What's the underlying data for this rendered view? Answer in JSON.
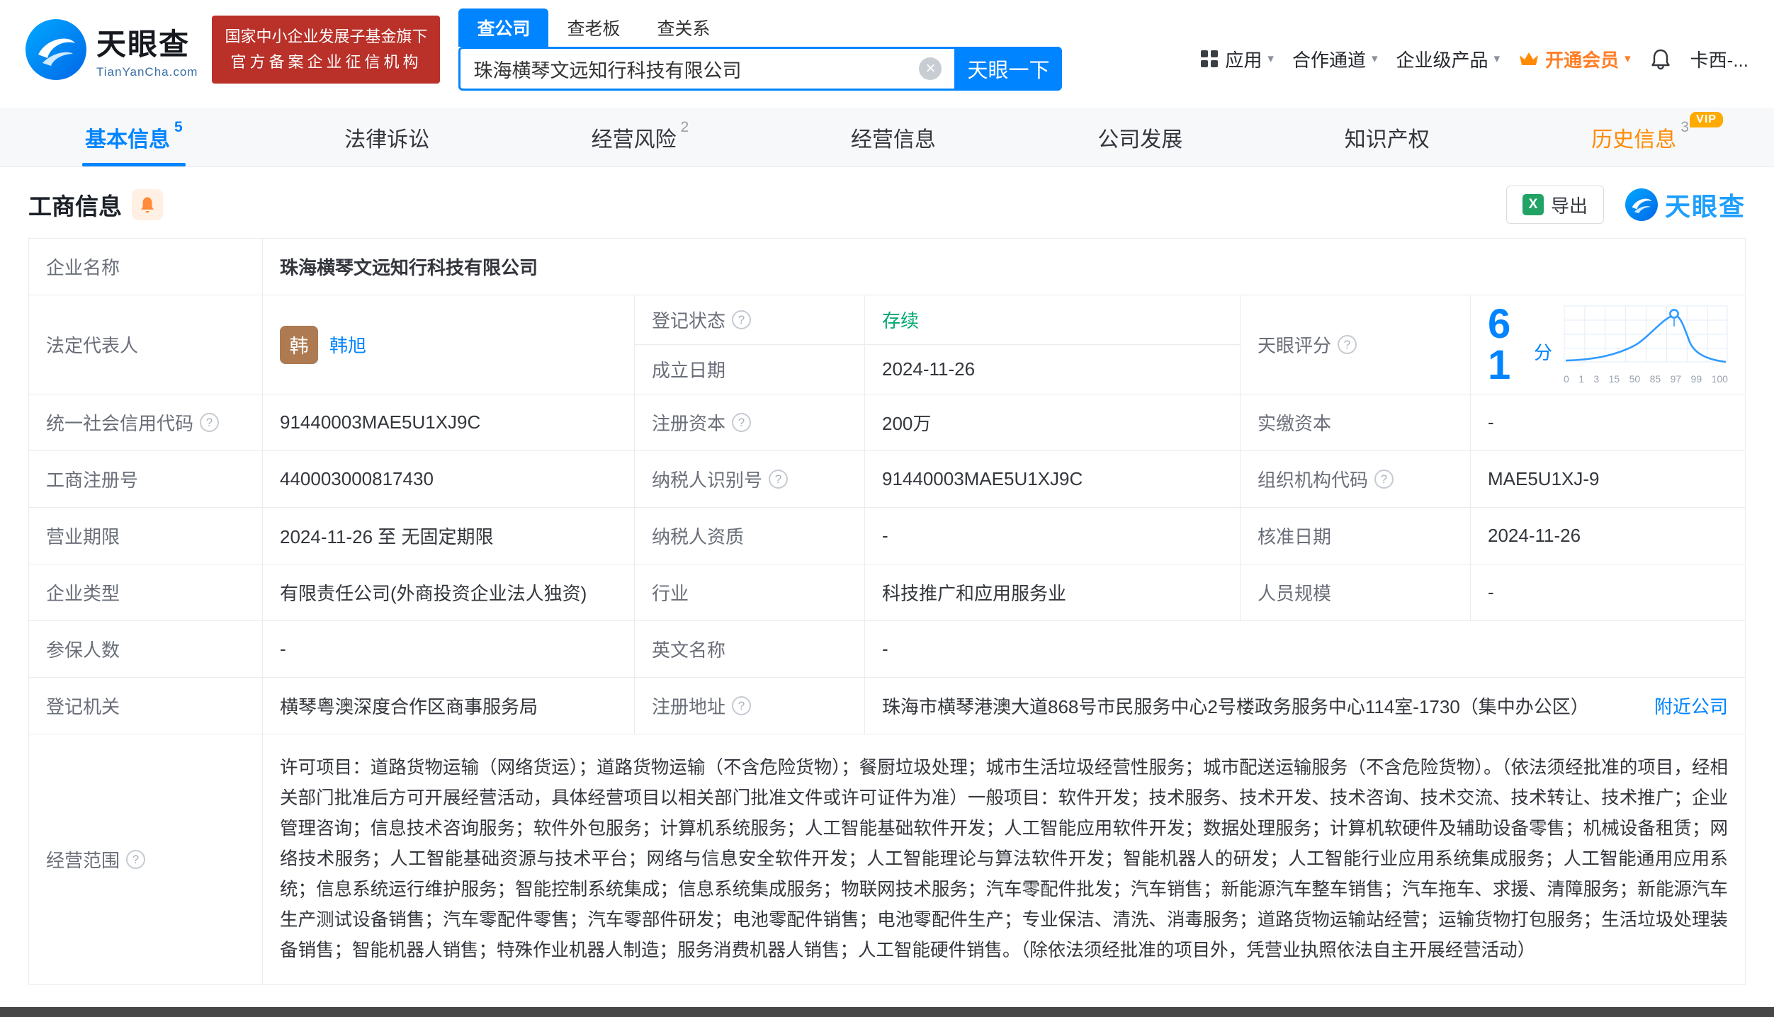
{
  "header": {
    "logo": {
      "cn": "天眼查",
      "en": "TianYanCha.com"
    },
    "badge": {
      "line1": "国家中小企业发展子基金旗下",
      "line2": "官方备案企业征信机构"
    },
    "search_tabs": [
      {
        "label": "查公司",
        "active": true
      },
      {
        "label": "查老板",
        "active": false
      },
      {
        "label": "查关系",
        "active": false
      }
    ],
    "search": {
      "value": "珠海横琴文远知行科技有限公司",
      "button": "天眼一下"
    },
    "nav": [
      {
        "label": "应用"
      },
      {
        "label": "合作通道"
      },
      {
        "label": "企业级产品"
      },
      {
        "label": "开通会员"
      }
    ],
    "user": "卡西-..."
  },
  "tabs": [
    {
      "label": "基本信息",
      "count": "5",
      "active": true
    },
    {
      "label": "法律诉讼",
      "count": ""
    },
    {
      "label": "经营风险",
      "count": "2"
    },
    {
      "label": "经营信息",
      "count": ""
    },
    {
      "label": "公司发展",
      "count": ""
    },
    {
      "label": "知识产权",
      "count": ""
    },
    {
      "label": "历史信息",
      "count": "3",
      "vip": "VIP"
    }
  ],
  "section": {
    "title": "工商信息",
    "export": "导出",
    "watermark": "天眼查"
  },
  "info": {
    "company_name": {
      "label": "企业名称",
      "value": "珠海横琴文远知行科技有限公司"
    },
    "legal_rep": {
      "label": "法定代表人",
      "avatar": "韩",
      "value": "韩旭"
    },
    "reg_status": {
      "label": "登记状态",
      "value": "存续"
    },
    "establish_date": {
      "label": "成立日期",
      "value": "2024-11-26"
    },
    "score": {
      "label": "天眼评分",
      "value": "61",
      "unit": "分"
    },
    "credit_code": {
      "label": "统一社会信用代码",
      "value": "91440003MAE5U1XJ9C"
    },
    "reg_capital": {
      "label": "注册资本",
      "value": "200万"
    },
    "paid_capital": {
      "label": "实缴资本",
      "value": "-"
    },
    "reg_number": {
      "label": "工商注册号",
      "value": "440003000817430"
    },
    "taxpayer_id": {
      "label": "纳税人识别号",
      "value": "91440003MAE5U1XJ9C"
    },
    "org_code": {
      "label": "组织机构代码",
      "value": "MAE5U1XJ-9"
    },
    "business_term": {
      "label": "营业期限",
      "value": "2024-11-26 至 无固定期限"
    },
    "taxpayer_quality": {
      "label": "纳税人资质",
      "value": "-"
    },
    "approval_date": {
      "label": "核准日期",
      "value": "2024-11-26"
    },
    "company_type": {
      "label": "企业类型",
      "value": "有限责任公司(外商投资企业法人独资)"
    },
    "industry": {
      "label": "行业",
      "value": "科技推广和应用服务业"
    },
    "staff_size": {
      "label": "人员规模",
      "value": "-"
    },
    "insured_count": {
      "label": "参保人数",
      "value": "-"
    },
    "english_name": {
      "label": "英文名称",
      "value": "-"
    },
    "reg_authority": {
      "label": "登记机关",
      "value": "横琴粤澳深度合作区商事服务局"
    },
    "reg_address": {
      "label": "注册地址",
      "value": "珠海市横琴港澳大道868号市民服务中心2号楼政务服务中心114室-1730（集中办公区）",
      "link": "附近公司"
    },
    "business_scope": {
      "label": "经营范围",
      "value": "许可项目：道路货物运输（网络货运）；道路货物运输（不含危险货物）；餐厨垃圾处理；城市生活垃圾经营性服务；城市配送运输服务（不含危险货物）。（依法须经批准的项目，经相关部门批准后方可开展经营活动，具体经营项目以相关部门批准文件或许可证件为准）一般项目：软件开发；技术服务、技术开发、技术咨询、技术交流、技术转让、技术推广；企业管理咨询；信息技术咨询服务；软件外包服务；计算机系统服务；人工智能基础软件开发；人工智能应用软件开发；数据处理服务；计算机软硬件及辅助设备零售；机械设备租赁；网络技术服务；人工智能基础资源与技术平台；网络与信息安全软件开发；人工智能理论与算法软件开发；智能机器人的研发；人工智能行业应用系统集成服务；人工智能通用应用系统；信息系统运行维护服务；智能控制系统集成；信息系统集成服务；物联网技术服务；汽车零配件批发；汽车销售；新能源汽车整车销售；汽车拖车、求援、清障服务；新能源汽车生产测试设备销售；汽车零配件零售；汽车零部件研发；电池零配件销售；电池零配件生产；专业保洁、清洗、消毒服务；道路货物运输站经营；运输货物打包服务；生活垃圾处理装备销售；智能机器人销售；特殊作业机器人制造；服务消费机器人销售；人工智能硬件销售。（除依法须经批准的项目外，凭营业执照依法自主开展经营活动）"
    }
  },
  "score_chart": {
    "type": "line",
    "x_labels": [
      "0",
      "1",
      "3",
      "15",
      "50",
      "85",
      "97",
      "99",
      "100"
    ]
  },
  "icons": {
    "clear": "×",
    "caret": "▾",
    "help": "?"
  }
}
